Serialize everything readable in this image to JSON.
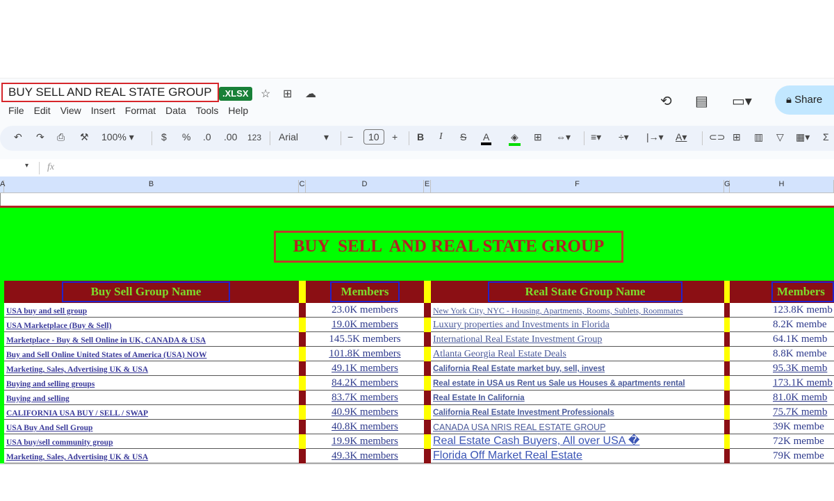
{
  "doc": {
    "title": "BUY  SELL  AND REAL STATE GROUP",
    "badge": ".XLSX"
  },
  "menu": [
    "File",
    "Edit",
    "View",
    "Insert",
    "Format",
    "Data",
    "Tools",
    "Help"
  ],
  "share_label": "Share",
  "toolbar": {
    "zoom": "100%",
    "currency": "$",
    "percent": "%",
    "dec_dec": ".0",
    "inc_dec": ".00",
    "number_format": "123",
    "font": "Arial",
    "font_size": "10",
    "fill_color": "#00ff00"
  },
  "formula_bar": {
    "fx": "fx"
  },
  "columns": [
    "A",
    "B",
    "C",
    "D",
    "E",
    "F",
    "G",
    "H"
  ],
  "sheet": {
    "title": "BUY  SELL  AND REAL STATE GROUP",
    "headers": {
      "buy_sell": "Buy Sell Group Name",
      "members1": "Members",
      "real_state": "Real State Group Name",
      "members2": "Members"
    },
    "colors": {
      "banner": "#00ff00",
      "header_bg": "#8b0f14",
      "header_text": "#7cdc2c",
      "stripe_red": "#8b0f14",
      "stripe_yellow": "#ffff00"
    },
    "rows": [
      {
        "buy": "USA buy and sell group",
        "buy_members": "23.0K members",
        "real": "New York City, NYC - Housing, Apartments, Rooms, Sublets, Roommates",
        "real_members": "123.8K memb"
      },
      {
        "buy": "USA Marketplace (Buy & Sell)",
        "buy_members": "19.0K members",
        "real": "Luxury properties and Investments in Florida",
        "real_members": "8.2K membe"
      },
      {
        "buy": "Marketplace - Buy & Sell Online in UK, CANADA & USA",
        "buy_members": "145.5K members",
        "real": "International Real Estate Investment Group",
        "real_members": "64.1K memb"
      },
      {
        "buy": "Buy and Sell Online United States of America (USA) NOW",
        "buy_members": "101.8K members",
        "real": "Atlanta Georgia Real Estate Deals",
        "real_members": "8.8K membe"
      },
      {
        "buy": "Marketing, Sales, Advertising UK & USA",
        "buy_members": "49.1K members",
        "real": "California Real Estate market buy, sell, invest",
        "real_members": "95.3K memb"
      },
      {
        "buy": "Buying and selling groups",
        "buy_members": "84.2K members",
        "real": "Real estate in USA us Rent us Sale us Houses & apartments rental",
        "real_members": "173.1K memb"
      },
      {
        "buy": "Buying and selling",
        "buy_members": "83.7K members",
        "real": "Real Estate In California",
        "real_members": "81.0K memb"
      },
      {
        "buy": "CALIFORNIA USA BUY / SELL / SWAP",
        "buy_members": "40.9K members",
        "real": "California Real Estate Investment Professionals",
        "real_members": "75.7K memb"
      },
      {
        "buy": "USA Buy And Sell Group",
        "buy_members": "40.8K members",
        "real": "CANADA USA NRIS REAL ESTATE GROUP",
        "real_members": "39K membe"
      },
      {
        "buy": "USA buy/sell community group",
        "buy_members": "19.9K members",
        "real": "Real Estate Cash Buyers, All over USA �",
        "real_members": "72K membe"
      },
      {
        "buy": "Marketing, Sales, Advertising UK & USA",
        "buy_members": "49.3K members",
        "real": "Florida Off Market Real Estate",
        "real_members": "79K membe"
      }
    ]
  }
}
